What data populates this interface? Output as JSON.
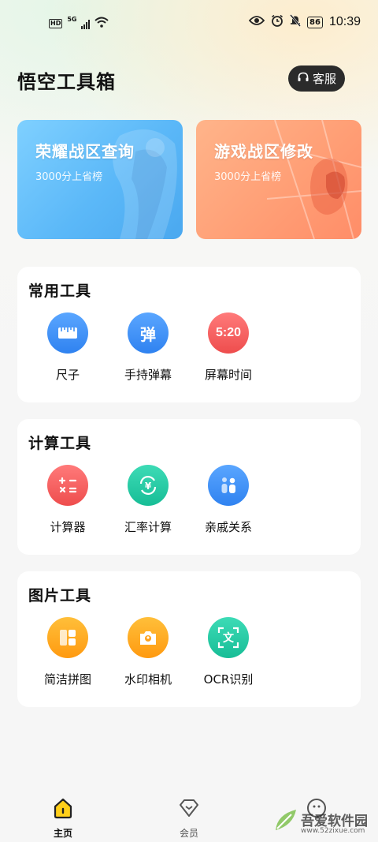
{
  "status_bar": {
    "hd": "HD",
    "network": "5G",
    "battery": "86",
    "time": "10:39"
  },
  "header": {
    "title": "悟空工具箱",
    "service_label": "客服"
  },
  "banners": [
    {
      "title": "荣耀战区查询",
      "subtitle": "3000分上省榜"
    },
    {
      "title": "游戏战区修改",
      "subtitle": "3000分上省榜"
    }
  ],
  "sections": [
    {
      "title": "常用工具",
      "tools": [
        {
          "label": "尺子",
          "icon": "ruler-icon",
          "color": "#3b8ff5"
        },
        {
          "label": "手持弹幕",
          "icon": "bullet-comment-icon",
          "color": "#3b8ff5",
          "glyph": "弹"
        },
        {
          "label": "屏幕时间",
          "icon": "screen-time-icon",
          "color": "#f25757",
          "glyph": "5:20"
        }
      ]
    },
    {
      "title": "计算工具",
      "tools": [
        {
          "label": "计算器",
          "icon": "calculator-icon",
          "color": "#f25757"
        },
        {
          "label": "汇率计算",
          "icon": "exchange-rate-icon",
          "color": "#20c9a3"
        },
        {
          "label": "亲戚关系",
          "icon": "relatives-icon",
          "color": "#3b8ff5"
        }
      ]
    },
    {
      "title": "图片工具",
      "tools": [
        {
          "label": "简洁拼图",
          "icon": "collage-icon",
          "color": "#ffa21c"
        },
        {
          "label": "水印相机",
          "icon": "watermark-camera-icon",
          "color": "#ffa21c"
        },
        {
          "label": "OCR识别",
          "icon": "ocr-icon",
          "color": "#20c9a3",
          "glyph": "文"
        }
      ]
    }
  ],
  "bottom_nav": {
    "items": [
      {
        "label": "主页",
        "active": true
      },
      {
        "label": "会员",
        "active": false
      }
    ]
  },
  "watermark": {
    "text": "吾爱软件园",
    "url": "www.52zixue.com"
  }
}
